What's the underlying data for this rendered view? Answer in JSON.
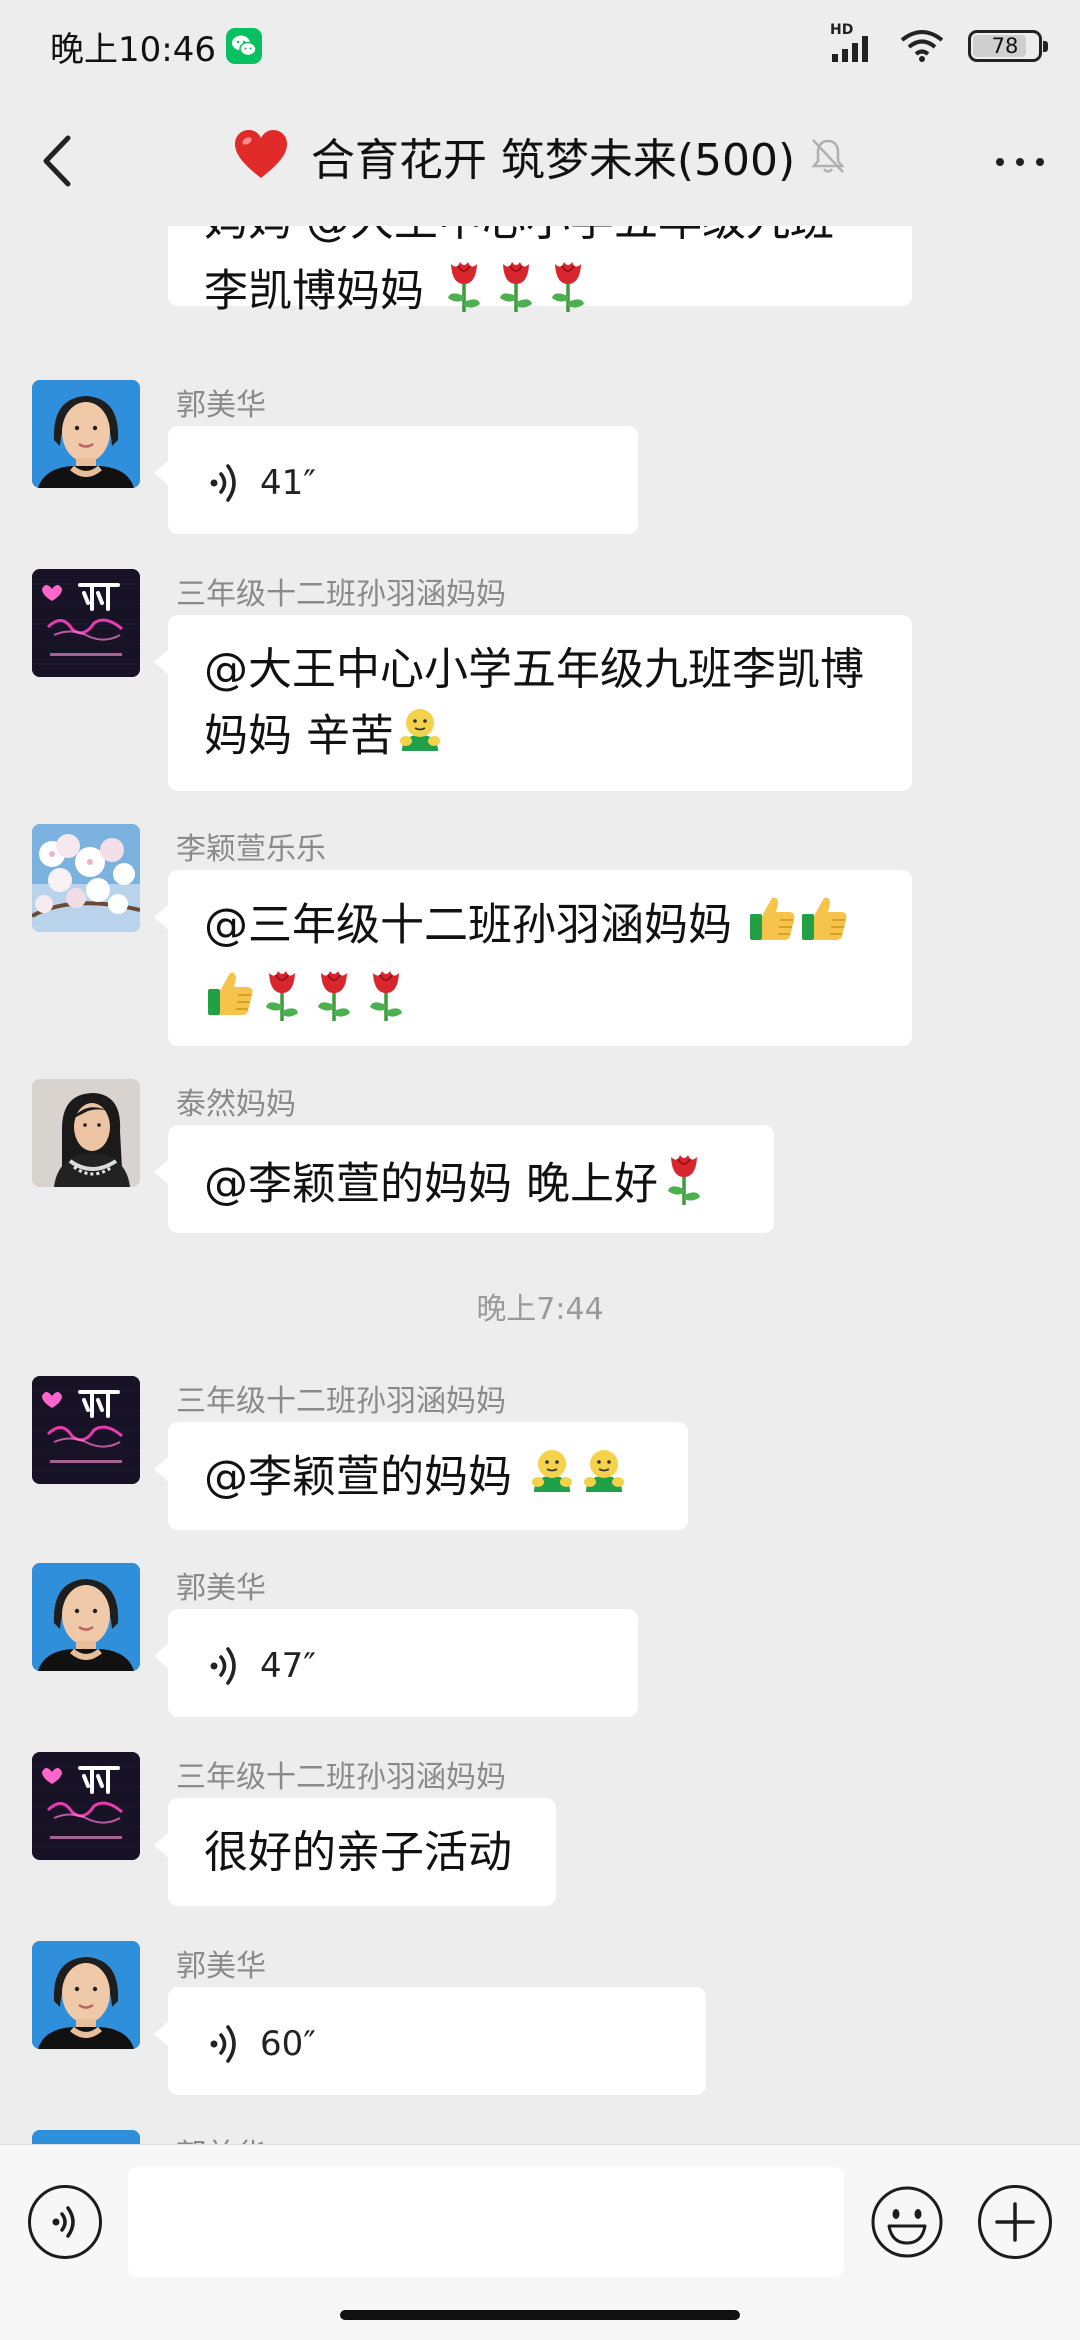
{
  "status_bar": {
    "time": "晚上10:46",
    "network": "HD",
    "battery": "78",
    "battery_level": 0.78
  },
  "header": {
    "title": "合育花开 筑梦未来(500)",
    "heart_icon": "red-heart-icon",
    "mute_icon": "bell-muted-icon",
    "more_icon": "more-dots-icon",
    "back_icon": "chevron-left-icon"
  },
  "colors": {
    "background": "#ededed",
    "bubble": "#ffffff",
    "wechat_green": "#07c160",
    "sender_gray": "#8a8a8a"
  },
  "messages": [
    {
      "id": "m0",
      "sender": "",
      "type": "text",
      "lines": [
        "妈妈 @大王中心小学五年级九班",
        "李凯博妈妈"
      ],
      "emojis": [
        "rose",
        "rose",
        "rose"
      ]
    },
    {
      "id": "m1",
      "sender": "郭美华",
      "type": "voice",
      "duration": "41″"
    },
    {
      "id": "m2",
      "sender": "三年级十二班孙羽涵妈妈",
      "type": "text",
      "lines": [
        "@大王中心小学五年级九班李凯博",
        "妈妈  辛苦"
      ],
      "emojis": [
        "hug"
      ]
    },
    {
      "id": "m3",
      "sender": "李颖萱乐乐",
      "type": "text",
      "lines": [
        "@三年级十二班孙羽涵妈妈"
      ],
      "emojis": [
        "thumbs-up",
        "thumbs-up",
        "thumbs-up",
        "rose",
        "rose",
        "rose"
      ]
    },
    {
      "id": "m4",
      "sender": "泰然妈妈",
      "type": "text",
      "lines": [
        "@李颖萱的妈妈  晚上好"
      ],
      "emojis": [
        "rose"
      ]
    },
    {
      "id": "ts",
      "type": "timestamp",
      "text": "晚上7:44"
    },
    {
      "id": "m5",
      "sender": "三年级十二班孙羽涵妈妈",
      "type": "text",
      "lines": [
        "@李颖萱的妈妈"
      ],
      "emojis": [
        "hug",
        "hug"
      ]
    },
    {
      "id": "m6",
      "sender": "郭美华",
      "type": "voice",
      "duration": "47″"
    },
    {
      "id": "m7",
      "sender": "三年级十二班孙羽涵妈妈",
      "type": "text",
      "lines": [
        "很好的亲子活动"
      ],
      "emojis": []
    },
    {
      "id": "m8",
      "sender": "郭美华",
      "type": "voice",
      "duration": "60″"
    },
    {
      "id": "m9",
      "sender": "郭美华",
      "type": "partial"
    }
  ],
  "input": {
    "value": "",
    "voice_icon": "voice-toggle-icon",
    "emoji_icon": "smiley-icon",
    "plus_icon": "plus-icon"
  }
}
